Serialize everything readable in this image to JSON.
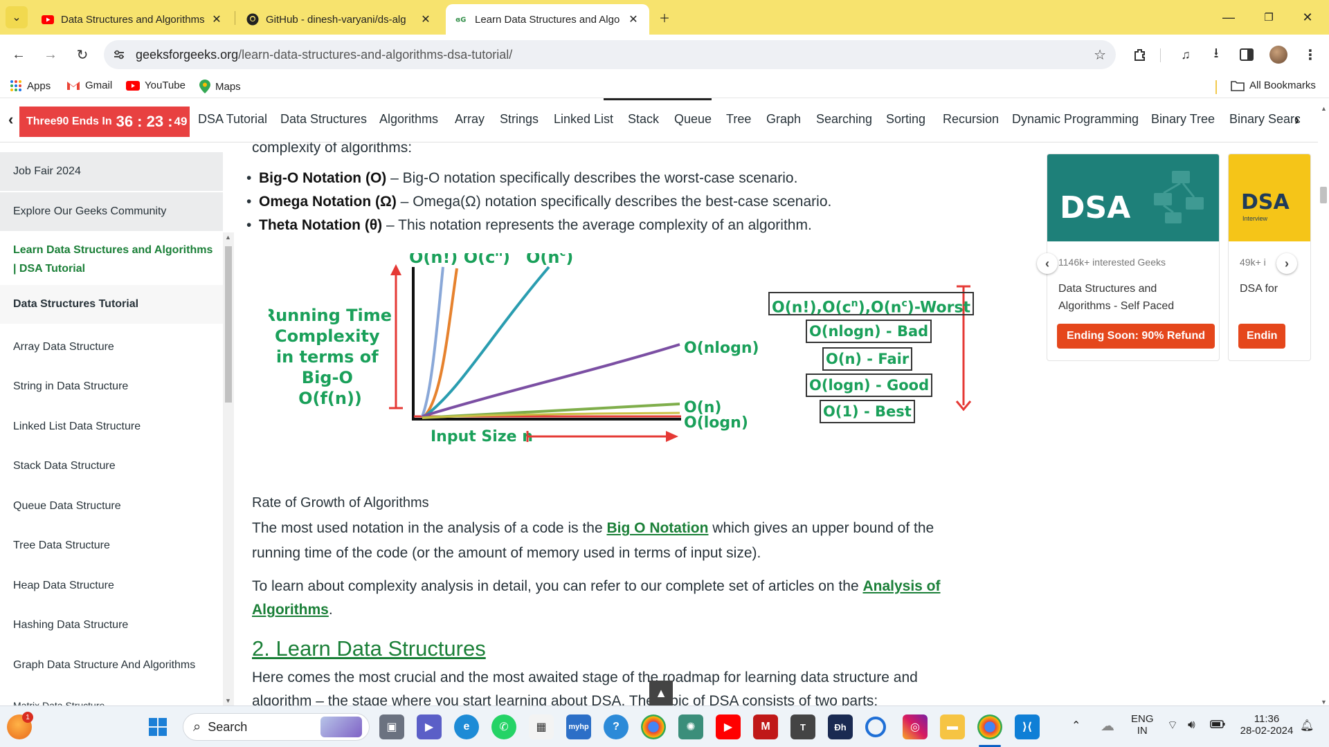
{
  "browser": {
    "tabs": [
      {
        "title": "Data Structures and Algorithms",
        "icon": "youtube-icon",
        "active": false
      },
      {
        "title": "GitHub - dinesh-varyani/ds-alg",
        "icon": "github-icon",
        "active": false
      },
      {
        "title": "Learn Data Structures and Algo",
        "icon": "gfg-icon",
        "active": true
      }
    ],
    "url_host": "geeksforgeeks.org",
    "url_path": "/learn-data-structures-and-algorithms-dsa-tutorial/",
    "bookmarks": [
      "Apps",
      "Gmail",
      "YouTube",
      "Maps"
    ],
    "all_bookmarks": "All Bookmarks"
  },
  "sitenav": {
    "promo_text": "Three90 Ends In",
    "promo_time_big": "36 : 23 :",
    "promo_time_small": "49",
    "items": [
      "DSA Tutorial",
      "Data Structures",
      "Algorithms",
      "Array",
      "Strings",
      "Linked List",
      "Stack",
      "Queue",
      "Tree",
      "Graph",
      "Searching",
      "Sorting",
      "Recursion",
      "Dynamic Programming",
      "Binary Tree",
      "Binary Searc"
    ]
  },
  "sidebar": {
    "items": [
      "Job Fair 2024",
      "Explore Our Geeks Community",
      "Learn Data Structures and Algorithms | DSA Tutorial",
      "Data Structures Tutorial",
      "Array Data Structure",
      "String in Data Structure",
      "Linked List Data Structure",
      "Stack Data Structure",
      "Queue Data Structure",
      "Tree Data Structure",
      "Heap Data Structure",
      "Hashing Data Structure",
      "Graph Data Structure And Algorithms",
      "Matrix Data Structure"
    ]
  },
  "article": {
    "intro_tail": "complexity of algorithms:",
    "bullets": [
      {
        "term": "Big-O Notation (O)",
        "desc": " – Big-O notation specifically describes the worst-case scenario."
      },
      {
        "term": "Omega Notation (Ω)",
        "desc": " – Omega(Ω) notation specifically describes the best-case scenario."
      },
      {
        "term": "Theta Notation (θ)",
        "desc": " – This notation represents the average complexity of an algorithm."
      }
    ],
    "figure": {
      "top_labels": [
        "O(n!) O(c",
        "n",
        ")",
        "O(n",
        "c",
        ")"
      ],
      "y_label": [
        "Running Time",
        "Complexity",
        "in terms of",
        "Big-O",
        "O(f(n))"
      ],
      "x_label": "Input Size n",
      "curve_labels": [
        "O(nlogn)",
        "O(n)",
        "O(logn)"
      ],
      "legend": [
        "O(n!),O(c",
        "n",
        "),O(n",
        "c",
        ")-Worst",
        "O(nlogn) - Bad",
        "O(n) - Fair",
        "O(logn) - Good",
        "O(1) - Best"
      ],
      "colors": {
        "green": "#1aa05a",
        "red": "#e53935",
        "blue": "#2a9db0",
        "purple": "#7b4fa3",
        "orange": "#e6822e",
        "lightblue": "#8aa8d8",
        "olive": "#7fae4b"
      }
    },
    "caption": "Rate of Growth of Algorithms",
    "para1_a": "The most used notation in the analysis of a code is the ",
    "para1_link": "Big O Notation",
    "para1_b": " which gives an upper bound of the",
    "para1_line2": "running time of the code (or the amount of memory used in terms of input size).",
    "para2_a": "To learn about complexity analysis in detail, you can refer to our complete set of articles on the ",
    "para2_link_1": "Analysis of",
    "para2_link_2": "Algorithms",
    "para2_end": ".",
    "heading": "2. Learn Data Structures",
    "para3": "Here comes the most crucial and the most awaited stage of the roadmap for learning data structure and",
    "para3_line2": "algorithm – the stage where you start learning about DSA. The topic of DSA consists of two parts:"
  },
  "ads": {
    "card1": {
      "banner": "DSA",
      "interest": "1146k+ interested Geeks",
      "title": "Data Structures and Algorithms - Self Paced",
      "cta": "Ending Soon: 90% Refund"
    },
    "card2": {
      "banner": "DSA",
      "banner_sub": "Interview",
      "interest": "49k+ i",
      "title": "DSA for",
      "cta": "Endin"
    }
  },
  "taskbar": {
    "search": "Search",
    "lang": "ENG",
    "region": "IN",
    "time": "11:36",
    "date": "28-02-2024",
    "notif_badge": "1"
  }
}
